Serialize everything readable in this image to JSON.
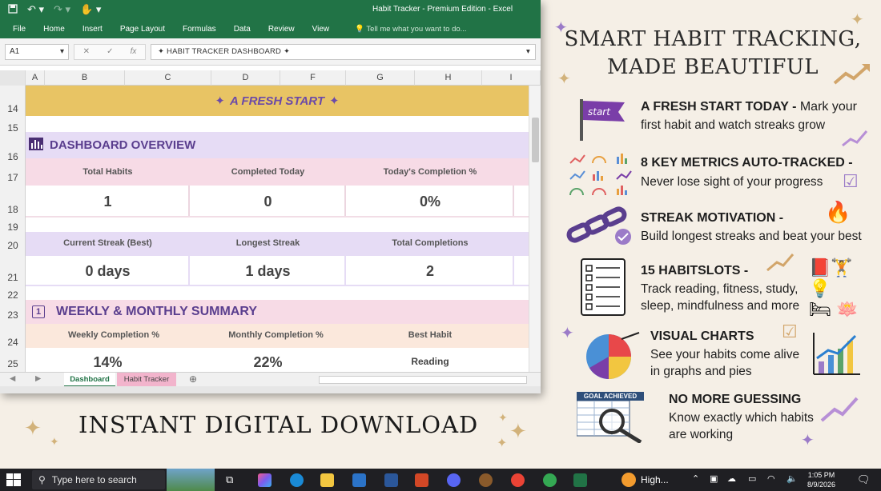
{
  "excel": {
    "window_title": "Habit Tracker - Premium Edition - Excel",
    "ribbon_tabs": [
      "File",
      "Home",
      "Insert",
      "Page Layout",
      "Formulas",
      "Data",
      "Review",
      "View"
    ],
    "tell_me": "Tell me what you want to do...",
    "name_box": "A1",
    "formula": "HABIT TRACKER DASHBOARD",
    "columns": [
      "A",
      "B",
      "C",
      "D",
      "E",
      "F",
      "G",
      "H",
      "I"
    ],
    "rows": [
      "14",
      "15",
      "16",
      "17",
      "18",
      "19",
      "20",
      "21",
      "22",
      "23",
      "24",
      "25"
    ],
    "banner": "A FRESH START",
    "dashboard_title": "DASHBOARD OVERVIEW",
    "metrics_row1": [
      {
        "label": "Total Habits",
        "value": "1"
      },
      {
        "label": "Completed Today",
        "value": "0"
      },
      {
        "label": "Today's Completion %",
        "value": "0%"
      }
    ],
    "metrics_row2": [
      {
        "label": "Current Streak (Best)",
        "value": "0 days"
      },
      {
        "label": "Longest Streak",
        "value": "1 days"
      },
      {
        "label": "Total Completions",
        "value": "2"
      }
    ],
    "summary_title": "WEEKLY & MONTHLY SUMMARY",
    "summary_icon": "1",
    "summary": [
      {
        "label": "Weekly Completion %",
        "value": "14%"
      },
      {
        "label": "Monthly Completion %",
        "value": "22%"
      },
      {
        "label": "Best Habit",
        "value": "Reading"
      }
    ],
    "sheet_tabs": [
      "Dashboard",
      "Habit Tracker"
    ]
  },
  "promo": {
    "headline_line1": "SMART HABIT TRACKING,",
    "headline_line2": "MADE BEAUTIFUL",
    "features": [
      {
        "title": "A FRESH START TODAY -",
        "text1": "Mark your",
        "text2": "first habit and watch streaks grow",
        "icon_label": "start"
      },
      {
        "title": "8 KEY METRICS AUTO-TRACKED -",
        "text1": "Never lose sight of your progress"
      },
      {
        "title": "STREAK MOTIVATION -",
        "text1": "Build longest streaks and beat your best"
      },
      {
        "title": "15 HABITSLOTS -",
        "text1": "Track reading, fitness, study,",
        "text2": "sleep, mindfulness and more"
      },
      {
        "title": "VISUAL CHARTS",
        "text1": "See your habits come alive",
        "text2": "in graphs and pies"
      },
      {
        "title": "NO MORE GUESSING",
        "text1": "Know exactly which habits",
        "text2": "are working",
        "icon_label": "GOAL ACHIEVED"
      }
    ],
    "download": "INSTANT DIGITAL DOWNLOAD"
  },
  "taskbar": {
    "search_placeholder": "Type here to search",
    "app_label": "High...",
    "time": "1:05 PM",
    "date": "8/9/2026"
  },
  "colors": {
    "excel_green": "#217346",
    "banner_gold": "#e8c464",
    "lavender": "#e6dcf5",
    "pink": "#f7dbe6",
    "peach": "#fbe8dc",
    "purple_text": "#5a3e8e"
  }
}
